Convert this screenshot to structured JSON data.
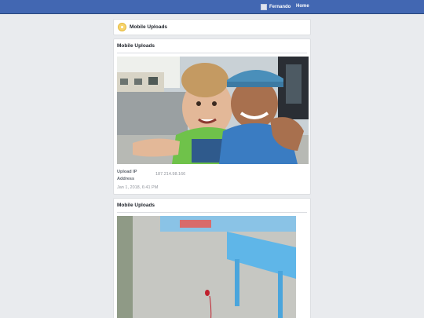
{
  "topbar": {
    "user_name": "Fernando",
    "home_label": "Home"
  },
  "header": {
    "title": "Mobile Uploads"
  },
  "posts": [
    {
      "section_title": "Mobile Uploads",
      "upload_ip_label": "Upload IP Address",
      "upload_ip_value": "187.214.98.166",
      "date": "Jan 1, 2018, 6:41 PM"
    },
    {
      "section_title": "Mobile Uploads"
    }
  ],
  "colors": {
    "brand_blue": "#4267b2",
    "background": "#e9ebee"
  }
}
